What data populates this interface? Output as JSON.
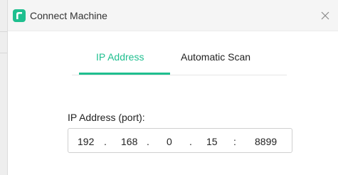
{
  "window": {
    "title": "Connect Machine"
  },
  "tabs": [
    {
      "label": "IP Address",
      "active": true
    },
    {
      "label": "Automatic Scan",
      "active": false
    }
  ],
  "form": {
    "label": "IP Address (port):",
    "ip": {
      "octet1": "192",
      "octet2": "168",
      "octet3": "0",
      "octet4": "15",
      "dot": ".",
      "colon": ":",
      "port": "8899"
    }
  },
  "colors": {
    "accent": "#1fbf8f",
    "titlebar": "#f5f5f5",
    "text": "#222222"
  },
  "icons": {
    "logo": "app-logo-icon",
    "close": "close-icon"
  }
}
